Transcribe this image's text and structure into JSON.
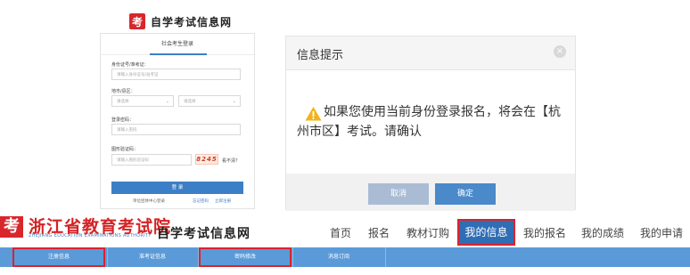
{
  "login": {
    "brand_title": "自学考试信息网",
    "tab_label": "社会考生登录",
    "id_label": "身份证号/准考证：",
    "id_placeholder": "请输入身份证号/准考证",
    "region_label": "地市/县区：",
    "city_select": "请选择",
    "district_select": "请选择",
    "password_label": "登录密码：",
    "password_placeholder": "请输入密码",
    "captcha_label": "图形验证码：",
    "captcha_placeholder": "请输入图形验证码",
    "captcha_text": "8245",
    "captcha_refresh": "看不清？",
    "login_button": "登 录",
    "link_left": "单位团体中心登录",
    "link_mid": "忘记密码",
    "link_right": "立即注册"
  },
  "dialog": {
    "title": "信息提示",
    "close_glyph": "×",
    "message": "如果您使用当前身份登录报名，将会在【杭州市区】考试。请确认",
    "cancel": "取消",
    "ok": "确定"
  },
  "site": {
    "logo_glyph": "考",
    "name": "浙江省教育考试院",
    "subname": "ZHEJIANG EDUCATION EXAMINATIONS AUTHORITY",
    "slogan": "自学考试信息网"
  },
  "topnav": [
    "首页",
    "报名",
    "教材订购",
    "我的信息",
    "我的报名",
    "我的成绩",
    "我的申请"
  ],
  "subnav": [
    "注册信息",
    "准考证信息",
    "密码修改",
    "消息订阅"
  ],
  "colors": {
    "brand_red": "#d8262c",
    "primary_blue": "#3d7fc6",
    "subnav_blue": "#5b9ad8",
    "highlight_red": "#d9232d",
    "warning_yellow": "#f2b31a"
  }
}
